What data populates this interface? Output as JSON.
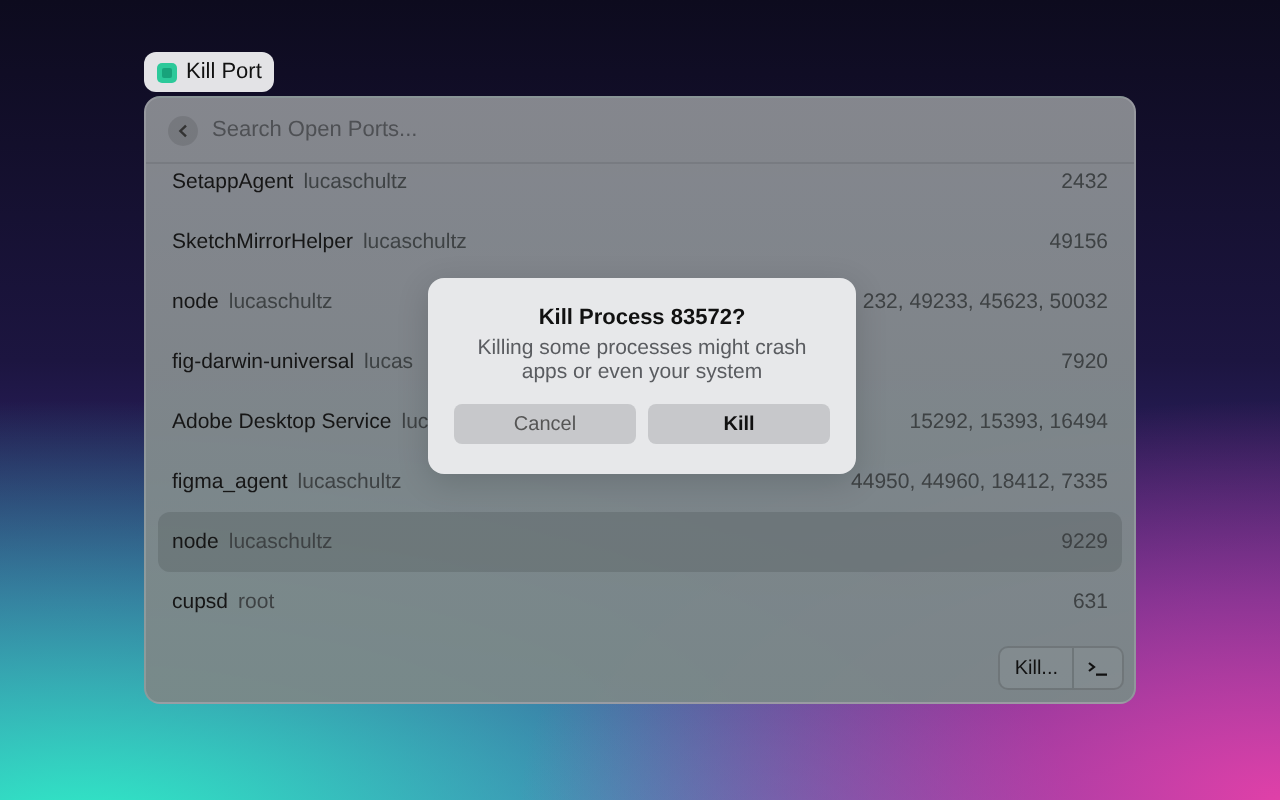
{
  "app_title": "Kill Port",
  "search": {
    "placeholder": "Search Open Ports..."
  },
  "processes": [
    {
      "name": "SetappAgent",
      "user": "lucaschultz",
      "ports": "2432",
      "selected": false
    },
    {
      "name": "SketchMirrorHelper",
      "user": "lucaschultz",
      "ports": "49156",
      "selected": false
    },
    {
      "name": "node",
      "user": "lucaschultz",
      "ports": "232, 49233, 45623, 50032",
      "selected": false
    },
    {
      "name": "fig-darwin-universal",
      "user": "lucas",
      "ports": "7920",
      "selected": false
    },
    {
      "name": "Adobe Desktop Service",
      "user": "luc",
      "ports": "15292, 15393, 16494",
      "selected": false
    },
    {
      "name": "figma_agent",
      "user": "lucaschultz",
      "ports": "44950, 44960, 18412, 7335",
      "selected": false
    },
    {
      "name": "node",
      "user": "lucaschultz",
      "ports": "9229",
      "selected": true
    },
    {
      "name": "cupsd",
      "user": "root",
      "ports": "631",
      "selected": false
    }
  ],
  "dialog": {
    "title": "Kill Process 83572?",
    "message": "Killing some processes might crash apps or even your system",
    "buttons": [
      {
        "label": "Cancel",
        "kind": "secondary"
      },
      {
        "label": "Kill",
        "kind": "primary"
      }
    ]
  },
  "footer": {
    "action": "Kill..."
  }
}
